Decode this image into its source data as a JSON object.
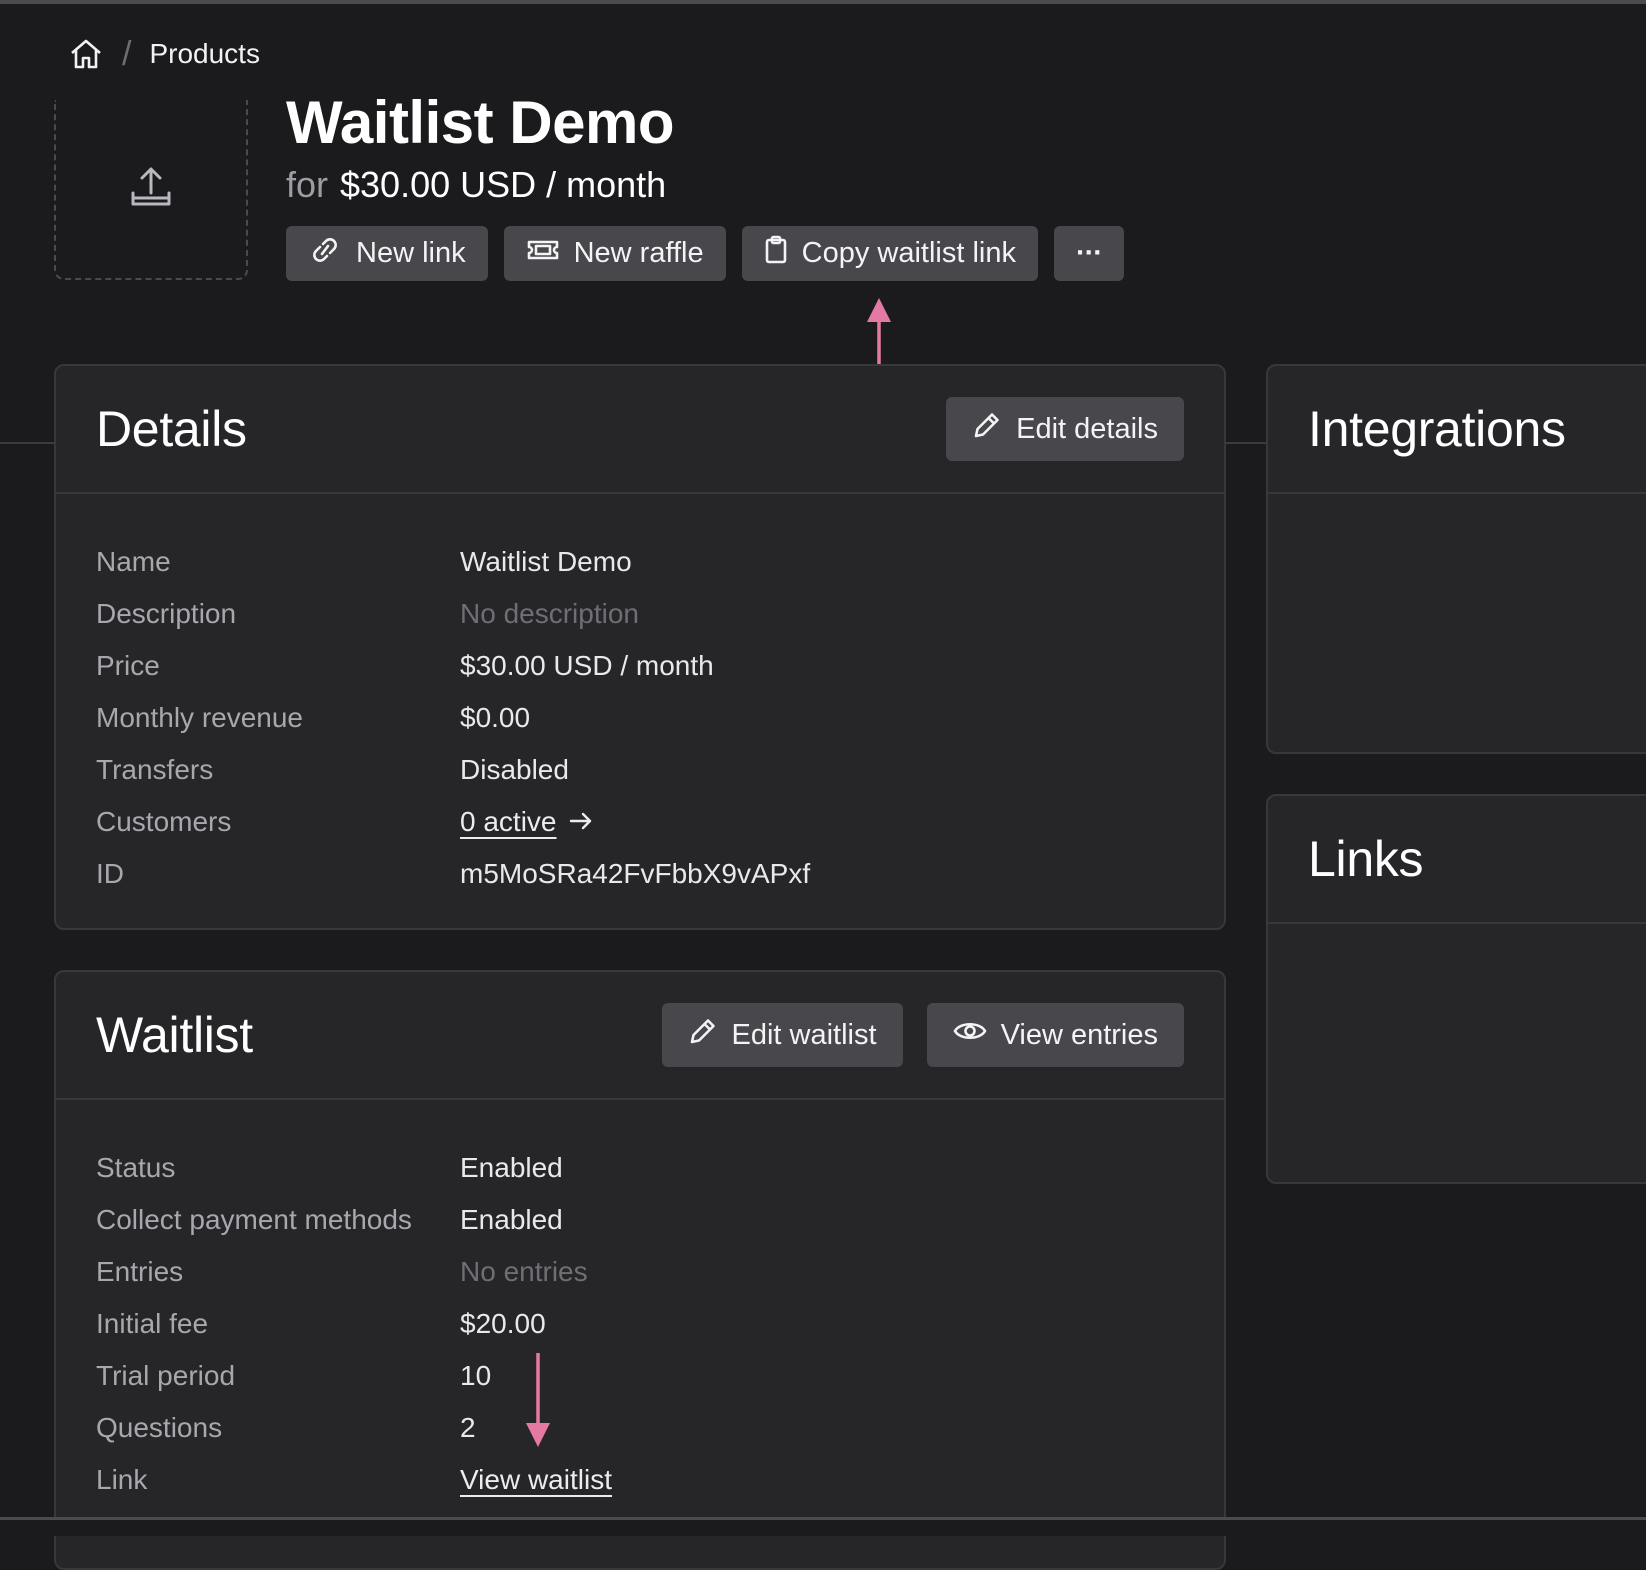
{
  "breadcrumb": {
    "home_icon": "home-icon",
    "separator": "/",
    "current": "Products"
  },
  "product": {
    "title": "Waitlist Demo",
    "for_label": "for",
    "price": "$30.00 USD / month",
    "upload_icon": "upload-icon"
  },
  "actions": {
    "new_link": "New link",
    "new_raffle": "New raffle",
    "copy_waitlist_link": "Copy waitlist link",
    "more": "···"
  },
  "details": {
    "title": "Details",
    "edit_button": "Edit details",
    "rows": [
      {
        "label": "Name",
        "value": "Waitlist Demo"
      },
      {
        "label": "Description",
        "value": "No description"
      },
      {
        "label": "Price",
        "value": "$30.00 USD / month"
      },
      {
        "label": "Monthly revenue",
        "value": "$0.00"
      },
      {
        "label": "Transfers",
        "value": "Disabled"
      },
      {
        "label": "Customers",
        "value": "0 active"
      },
      {
        "label": "ID",
        "value": "m5MoSRa42FvFbbX9vAPxf"
      }
    ]
  },
  "waitlist": {
    "title": "Waitlist",
    "edit_button": "Edit waitlist",
    "view_button": "View entries",
    "rows": [
      {
        "label": "Status",
        "value": "Enabled"
      },
      {
        "label": "Collect payment methods",
        "value": "Enabled"
      },
      {
        "label": "Entries",
        "value": "No entries"
      },
      {
        "label": "Initial fee",
        "value": "$20.00"
      },
      {
        "label": "Trial period",
        "value": "10"
      },
      {
        "label": "Questions",
        "value": "2"
      },
      {
        "label": "Link",
        "value": "View waitlist"
      }
    ]
  },
  "sidebar": {
    "integrations_title": "Integrations",
    "links_title": "Links"
  },
  "colors": {
    "background": "#1b1b1e",
    "card": "#262629",
    "button": "#47474c",
    "annotation_arrow": "#e47aa3"
  }
}
